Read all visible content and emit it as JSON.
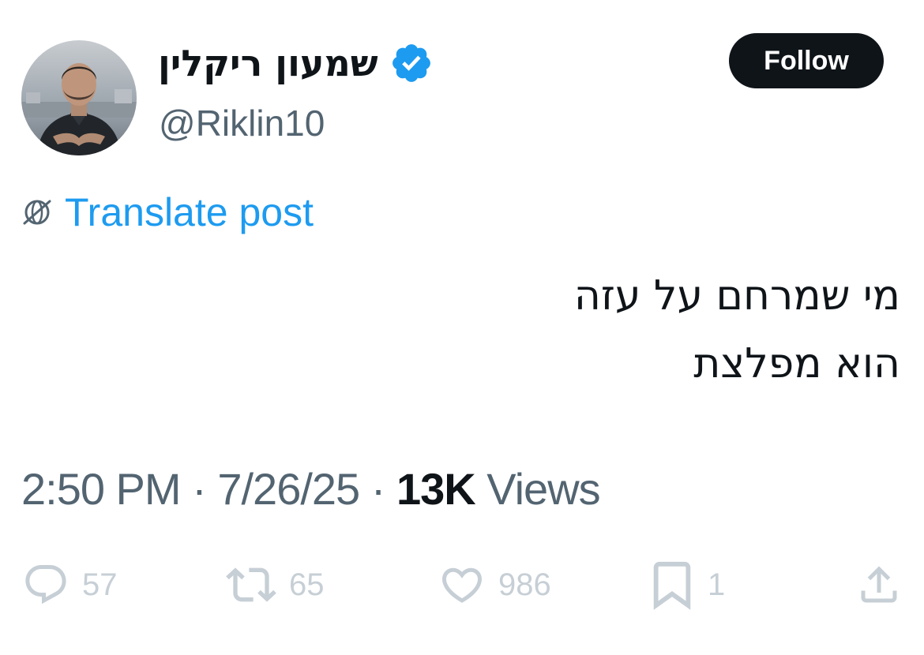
{
  "author": {
    "display_name": "שמעון ריקלין",
    "handle": "@Riklin10",
    "verified": true,
    "avatar_icon": "profile-photo"
  },
  "follow_button": {
    "label": "Follow"
  },
  "translate": {
    "label": "Translate post",
    "icon": "globe-icon"
  },
  "post": {
    "lines": [
      "מי שמרחם על עזה",
      "הוא מפלצת"
    ]
  },
  "meta": {
    "time": "2:50 PM",
    "separator": "·",
    "date": "7/26/25",
    "views_count": "13K",
    "views_label": "Views"
  },
  "actions": {
    "replies": "57",
    "reposts": "65",
    "likes": "986",
    "bookmarks": "1"
  },
  "colors": {
    "accent": "#1d9bf0",
    "text_primary": "#0f1419",
    "text_secondary": "#536471",
    "action_icons": "#c7cfd6",
    "follow_bg": "#0f1419"
  }
}
